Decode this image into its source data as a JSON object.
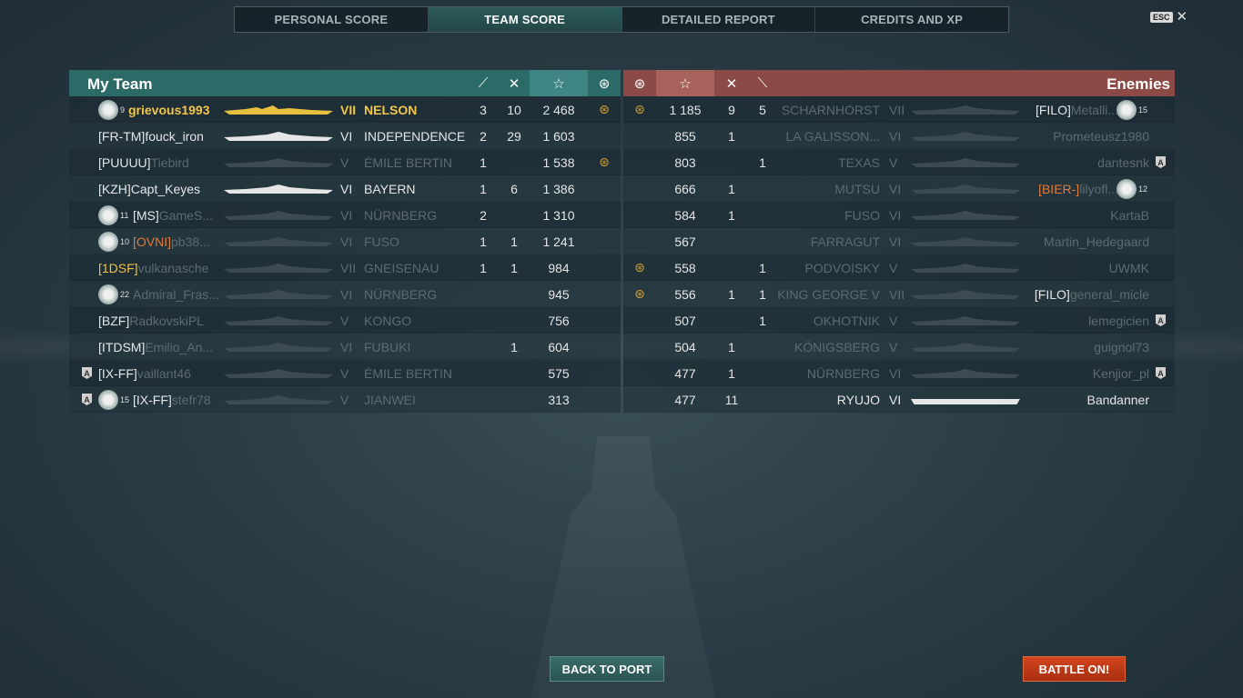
{
  "tabs": [
    {
      "label": "PERSONAL SCORE"
    },
    {
      "label": "TEAM SCORE"
    },
    {
      "label": "DETAILED REPORT"
    },
    {
      "label": "CREDITS AND XP"
    }
  ],
  "esc_label": "ESC",
  "my_team": {
    "title": "My Team",
    "rows": [
      {
        "clan": "",
        "name": "grievous1993",
        "tier": "VII",
        "ship": "NELSON",
        "kills": "3",
        "planes": "10",
        "score": "2 468",
        "level": "9"
      },
      {
        "clan": "[FR-TM]",
        "name": "fouck_iron",
        "tier": "VI",
        "ship": "INDEPENDENCE",
        "kills": "2",
        "planes": "29",
        "score": "1 603",
        "level": ""
      },
      {
        "clan": "[PUUUU]",
        "name": "Tiebird",
        "tier": "V",
        "ship": "ÉMILE BERTIN",
        "kills": "1",
        "planes": "",
        "score": "1 538",
        "level": ""
      },
      {
        "clan": "[KZH]",
        "name": "Capt_Keyes",
        "tier": "VI",
        "ship": "BAYERN",
        "kills": "1",
        "planes": "6",
        "score": "1 386",
        "level": ""
      },
      {
        "clan": "[MS]",
        "name": "GameS...",
        "tier": "VI",
        "ship": "NÜRNBERG",
        "kills": "2",
        "planes": "",
        "score": "1 310",
        "level": "11"
      },
      {
        "clan": "[OVNI]",
        "name": "pb38...",
        "tier": "VI",
        "ship": "FUSO",
        "kills": "1",
        "planes": "1",
        "score": "1 241",
        "level": "10"
      },
      {
        "clan": "[1DSF]",
        "name": "vulkanasche",
        "tier": "VII",
        "ship": "GNEISENAU",
        "kills": "1",
        "planes": "1",
        "score": "984",
        "level": ""
      },
      {
        "clan": "",
        "name": "Admiral_Fras...",
        "tier": "VI",
        "ship": "NÜRNBERG",
        "kills": "",
        "planes": "",
        "score": "945",
        "level": "22"
      },
      {
        "clan": "[BZF]",
        "name": "RadkovskiPL",
        "tier": "V",
        "ship": "KONGO",
        "kills": "",
        "planes": "",
        "score": "756",
        "level": ""
      },
      {
        "clan": "[ITDSM]",
        "name": "Emilio_An...",
        "tier": "VI",
        "ship": "FUBUKI",
        "kills": "",
        "planes": "1",
        "score": "604",
        "level": ""
      },
      {
        "clan": "[IX-FF]",
        "name": "vaillant46",
        "tier": "V",
        "ship": "ÉMILE BERTIN",
        "kills": "",
        "planes": "",
        "score": "575",
        "level": ""
      },
      {
        "clan": "[IX-FF]",
        "name": "stefr78",
        "tier": "V",
        "ship": "JIANWEI",
        "kills": "",
        "planes": "",
        "score": "313",
        "level": "15"
      }
    ]
  },
  "enemies": {
    "title": "Enemies",
    "rows": [
      {
        "score": "1 185",
        "planes": "9",
        "kills": "5",
        "ship": "SCHARNHORST",
        "tier": "VII",
        "clan": "[FILO]",
        "name": "Metalli...",
        "level": "15"
      },
      {
        "score": "855",
        "planes": "1",
        "kills": "",
        "ship": "LA GALISSON...",
        "tier": "VI",
        "clan": "",
        "name": "Prometeusz1980",
        "level": ""
      },
      {
        "score": "803",
        "planes": "",
        "kills": "1",
        "ship": "TEXAS",
        "tier": "V",
        "clan": "",
        "name": "dantesnk",
        "level": ""
      },
      {
        "score": "666",
        "planes": "1",
        "kills": "",
        "ship": "MUTSU",
        "tier": "VI",
        "clan": "[BIER-]",
        "name": "lilyofl...",
        "level": "12"
      },
      {
        "score": "584",
        "planes": "1",
        "kills": "",
        "ship": "FUSO",
        "tier": "VI",
        "clan": "",
        "name": "KartaB",
        "level": ""
      },
      {
        "score": "567",
        "planes": "",
        "kills": "",
        "ship": "FARRAGUT",
        "tier": "VI",
        "clan": "",
        "name": "Martin_Hedegaard",
        "level": ""
      },
      {
        "score": "558",
        "planes": "",
        "kills": "1",
        "ship": "PODVOISKY",
        "tier": "V",
        "clan": "",
        "name": "UWMK",
        "level": ""
      },
      {
        "score": "556",
        "planes": "1",
        "kills": "1",
        "ship": "KING GEORGE V",
        "tier": "VII",
        "clan": "[FILO]",
        "name": "general_micle",
        "level": ""
      },
      {
        "score": "507",
        "planes": "",
        "kills": "1",
        "ship": "OKHOTNIK",
        "tier": "V",
        "clan": "",
        "name": "lemegicien",
        "level": ""
      },
      {
        "score": "504",
        "planes": "1",
        "kills": "",
        "ship": "KÖNIGSBERG",
        "tier": "V",
        "clan": "",
        "name": "guignol73",
        "level": ""
      },
      {
        "score": "477",
        "planes": "1",
        "kills": "",
        "ship": "NÜRNBERG",
        "tier": "VI",
        "clan": "",
        "name": "Kenjior_pl",
        "level": ""
      },
      {
        "score": "477",
        "planes": "11",
        "kills": "",
        "ship": "RYUJO",
        "tier": "VI",
        "clan": "",
        "name": "Bandanner",
        "level": ""
      }
    ]
  },
  "buttons": {
    "back_to_port": "BACK TO PORT",
    "battle_on": "BATTLE ON!"
  },
  "icons": {
    "kills": "torpedo-icon",
    "planes": "crossed-swords-icon",
    "score": "star-icon",
    "medal": "medal-icon"
  },
  "colors": {
    "my_team_header": "#2b6a66",
    "enemy_header": "#8b4a45",
    "player_highlight": "#f2c64a",
    "battle_button": "#c23a18"
  }
}
